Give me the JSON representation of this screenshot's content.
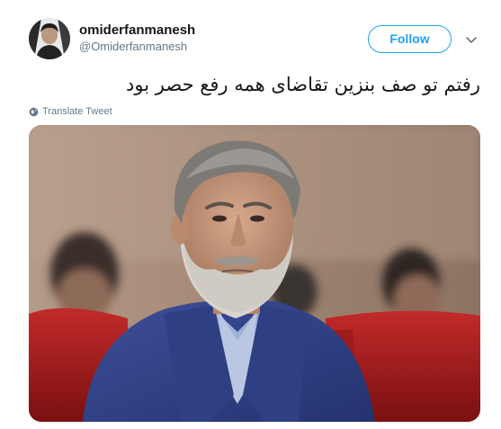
{
  "tweet": {
    "author": {
      "display_name": "omiderfanmanesh",
      "username": "@Omiderfanmanesh"
    },
    "follow_label": "Follow",
    "text": "رفتم تو صف بنزین تقاضای همه رفع حصر بود",
    "translate_label": "Translate Tweet"
  },
  "colors": {
    "accent": "#1da1f2",
    "secondary_text": "#657786",
    "primary_text": "#14171a"
  },
  "icons": {
    "more": "chevron-down-icon",
    "translate": "globe-icon"
  }
}
